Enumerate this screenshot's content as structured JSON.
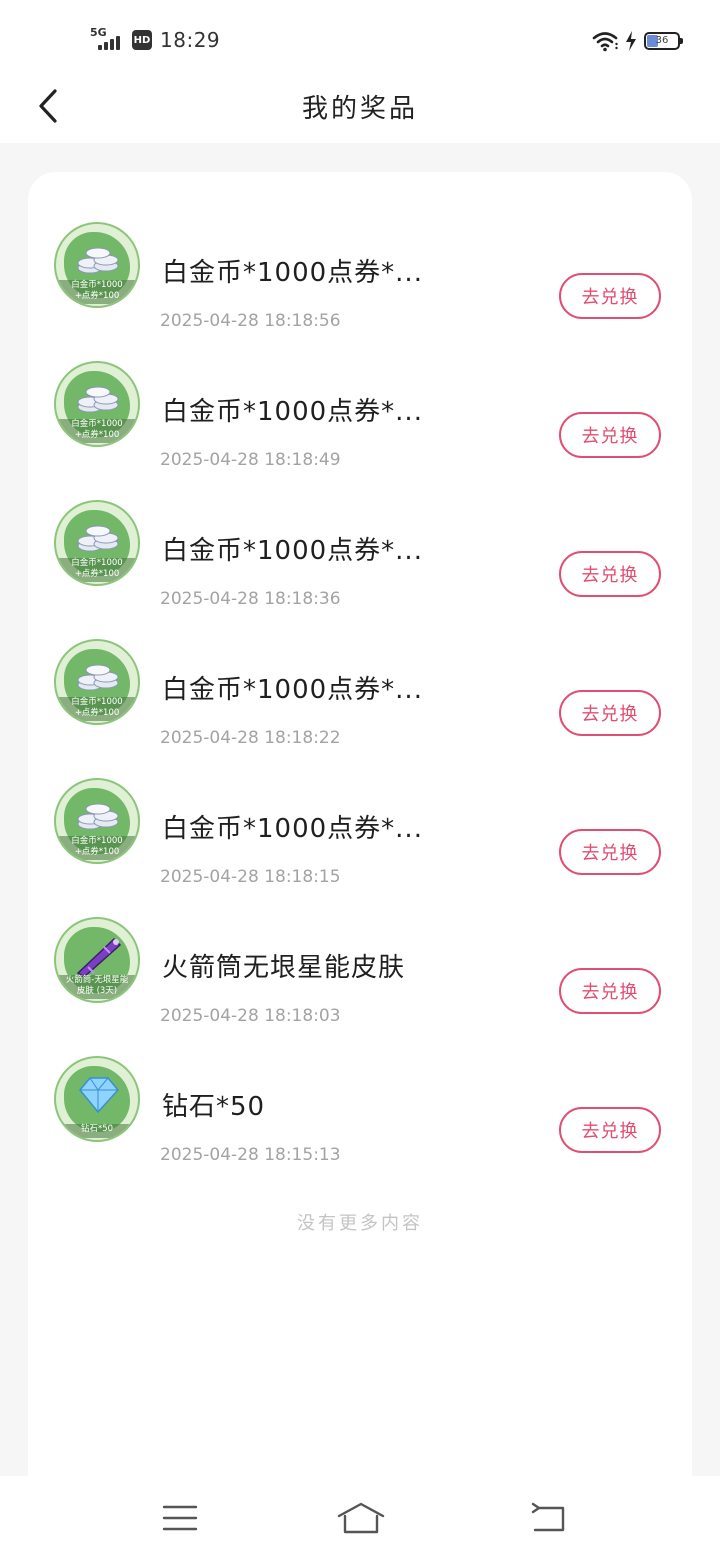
{
  "status_bar": {
    "network": "5G",
    "hd_badge": "HD",
    "time": "18:29",
    "battery_level": "36",
    "icons": [
      "signal-icon",
      "hd-icon",
      "wifi-icon",
      "charging-icon",
      "battery-icon"
    ]
  },
  "header": {
    "title": "我的奖品",
    "back_icon": "chevron-left-icon"
  },
  "prizes": [
    {
      "title": "白金币*1000点券*...",
      "time": "2025-04-28 18:18:56",
      "button": "去兑换",
      "thumb_caption": [
        "白金币*1000",
        "+点券*100"
      ],
      "thumb_icon": "coin-stack-icon"
    },
    {
      "title": "白金币*1000点券*...",
      "time": "2025-04-28 18:18:49",
      "button": "去兑换",
      "thumb_caption": [
        "白金币*1000",
        "+点券*100"
      ],
      "thumb_icon": "coin-stack-icon"
    },
    {
      "title": "白金币*1000点券*...",
      "time": "2025-04-28 18:18:36",
      "button": "去兑换",
      "thumb_caption": [
        "白金币*1000",
        "+点券*100"
      ],
      "thumb_icon": "coin-stack-icon"
    },
    {
      "title": "白金币*1000点券*...",
      "time": "2025-04-28 18:18:22",
      "button": "去兑换",
      "thumb_caption": [
        "白金币*1000",
        "+点券*100"
      ],
      "thumb_icon": "coin-stack-icon"
    },
    {
      "title": "白金币*1000点券*...",
      "time": "2025-04-28 18:18:15",
      "button": "去兑换",
      "thumb_caption": [
        "白金币*1000",
        "+点券*100"
      ],
      "thumb_icon": "coin-stack-icon"
    },
    {
      "title": "火箭筒无垠星能皮肤",
      "time": "2025-04-28 18:18:03",
      "button": "去兑换",
      "thumb_caption": [
        "火箭筒-无垠星能",
        "皮肤 (3天)"
      ],
      "thumb_icon": "rocket-launcher-icon"
    },
    {
      "title": "钻石*50",
      "time": "2025-04-28 18:15:13",
      "button": "去兑换",
      "thumb_caption": [
        "钻石*50"
      ],
      "thumb_icon": "diamond-icon"
    }
  ],
  "footer_note": "没有更多内容",
  "system_nav": {
    "icons": [
      "menu-icon",
      "home-icon",
      "back-icon"
    ]
  },
  "colors": {
    "accent": "#e04e72",
    "thumb_green": "#72b868",
    "subtext": "#a3a3a3"
  }
}
